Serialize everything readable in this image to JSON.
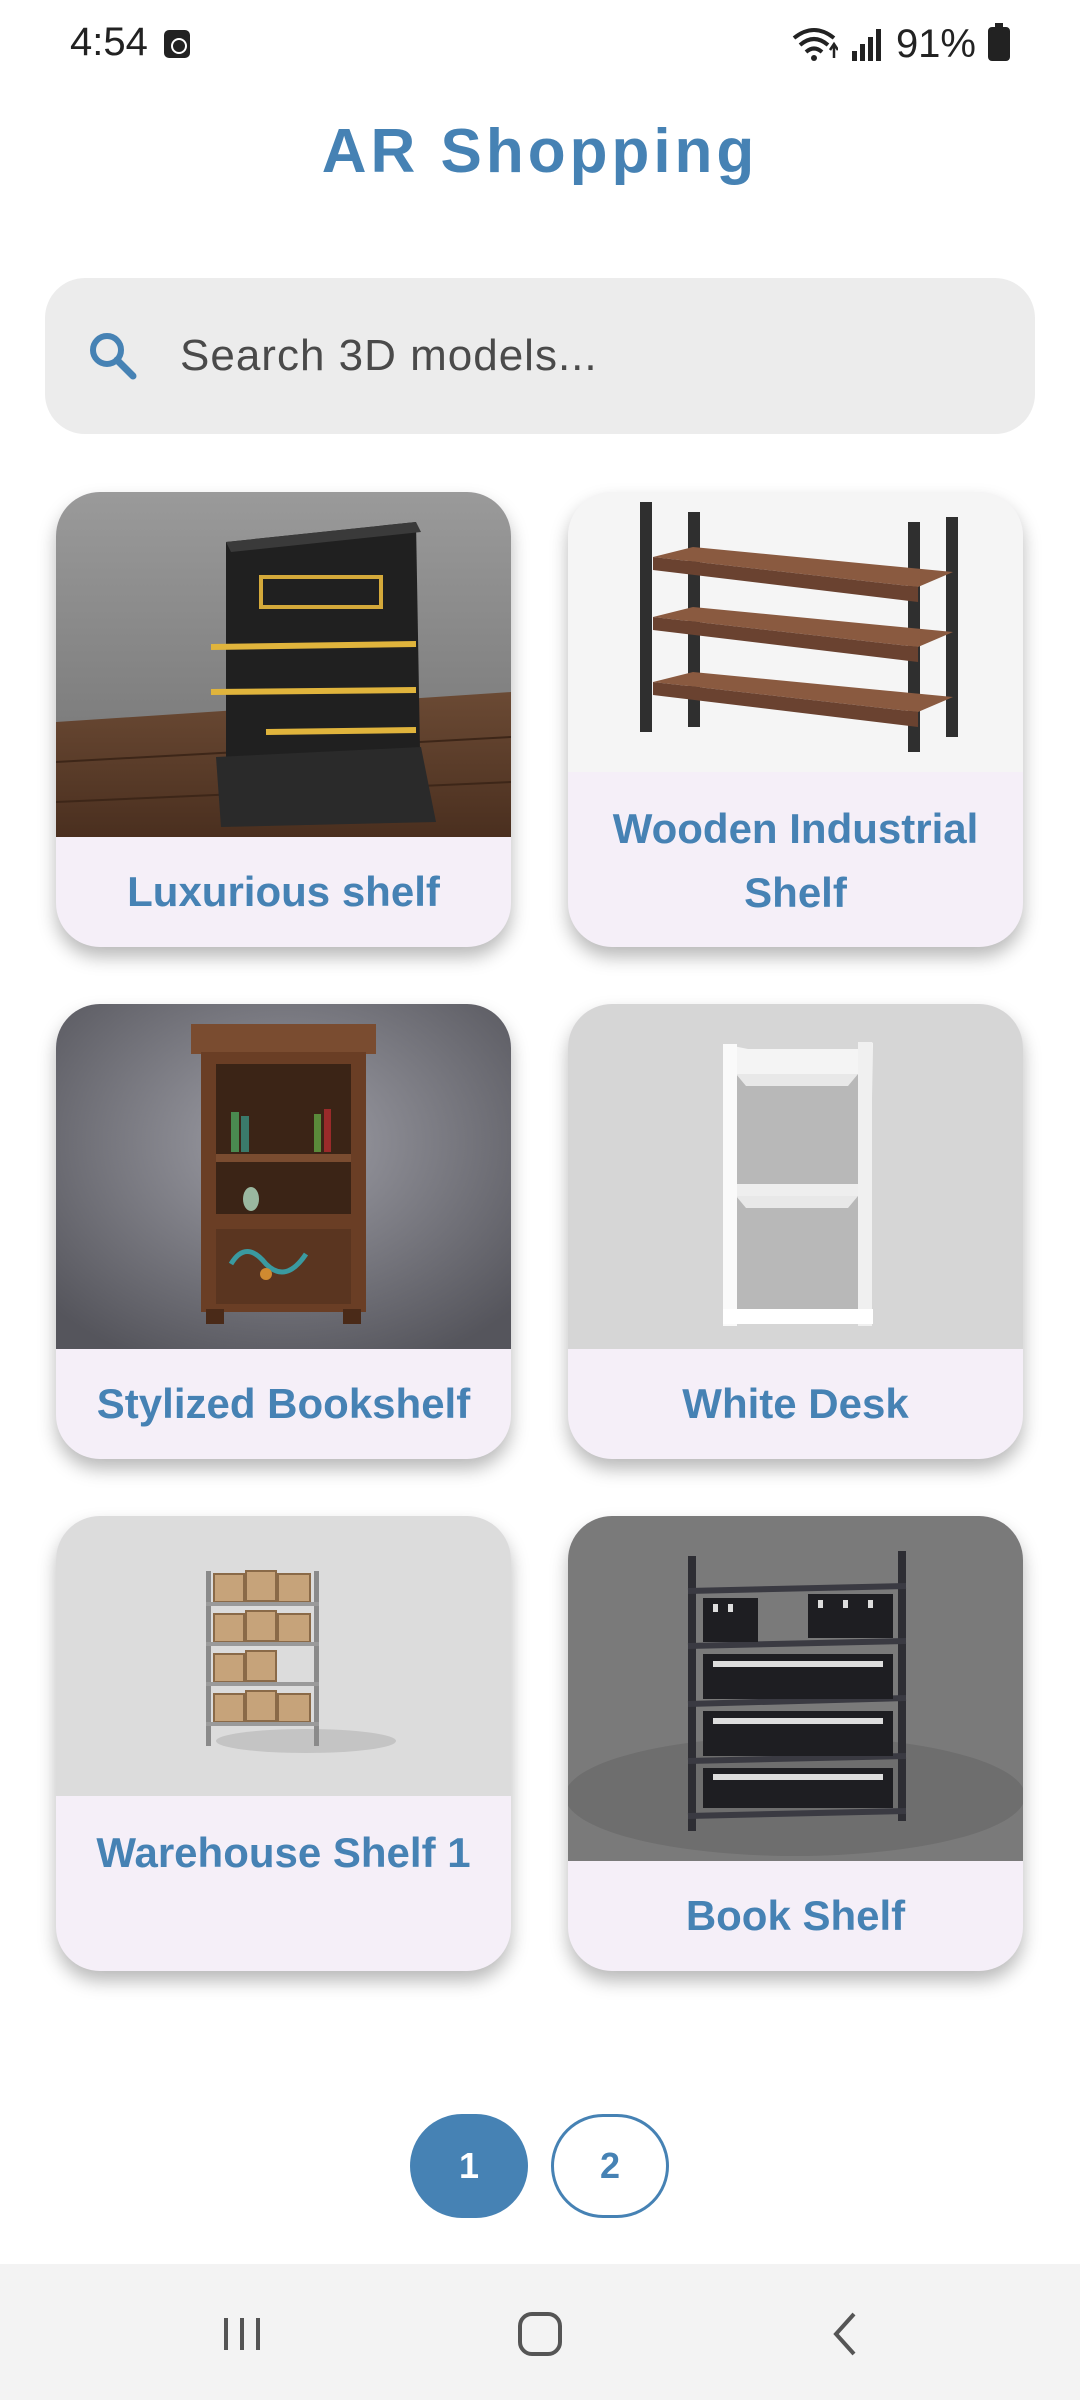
{
  "status_bar": {
    "time": "4:54",
    "battery": "91%"
  },
  "header": {
    "title": "AR Shopping"
  },
  "search": {
    "placeholder": "Search 3D models..."
  },
  "products": [
    {
      "label": "Luxurious shelf"
    },
    {
      "label": "Wooden Industrial Shelf"
    },
    {
      "label": "Stylized Bookshelf"
    },
    {
      "label": "White Desk"
    },
    {
      "label": "Warehouse Shelf 1"
    },
    {
      "label": "Book Shelf"
    }
  ],
  "pagination": {
    "pages": [
      "1",
      "2"
    ],
    "current": "1"
  },
  "colors": {
    "accent": "#4682b4",
    "card_bg": "#f5eff8",
    "search_bg": "#ececec"
  },
  "nav_bar": {
    "icons": [
      "recent-apps-icon",
      "home-icon",
      "back-icon"
    ]
  }
}
